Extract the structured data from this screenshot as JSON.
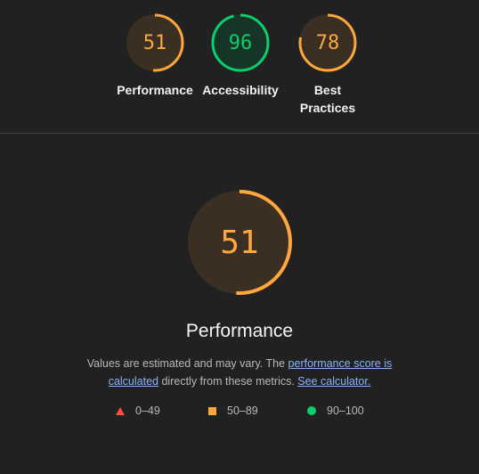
{
  "summary_gauges": [
    {
      "score": "51",
      "score_value": 51,
      "label": "Performance",
      "color": "#ffa63c",
      "bg": "#3a2f22"
    },
    {
      "score": "96",
      "score_value": 96,
      "label": "Accessibility",
      "color": "#0cce6b",
      "bg": "#163526"
    },
    {
      "score": "78",
      "score_value": 78,
      "label": "Best Practices",
      "color": "#ffa63c",
      "bg": "#3a2f22"
    }
  ],
  "main": {
    "score": "51",
    "score_value": 51,
    "title": "Performance",
    "color": "#ffa63c",
    "bg": "#3a2f22"
  },
  "description": {
    "text_before": "Values are estimated and may vary. The ",
    "link1": "performance score is calculated",
    "text_middle": " directly from these metrics. ",
    "link2": "See calculator."
  },
  "legend": [
    {
      "range": "0–49",
      "color": "#ff4e42",
      "shape": "triangle"
    },
    {
      "range": "50–89",
      "color": "#ffa63c",
      "shape": "square"
    },
    {
      "range": "90–100",
      "color": "#0cce6b",
      "shape": "circle"
    }
  ]
}
